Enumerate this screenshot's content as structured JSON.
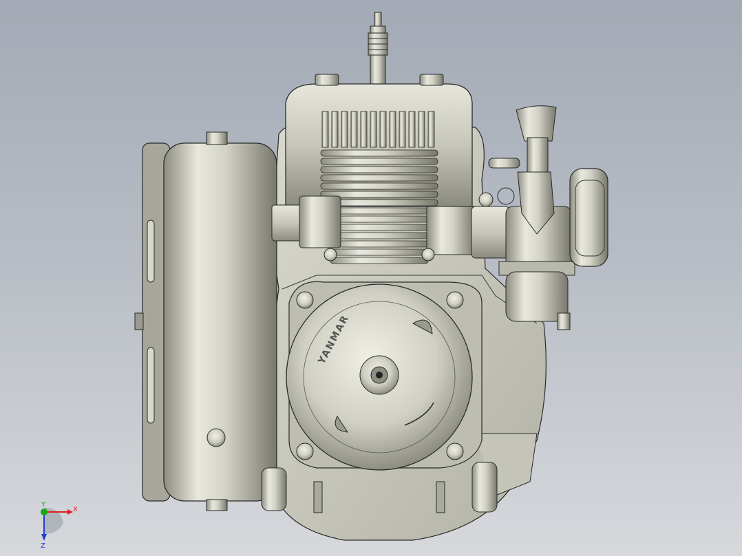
{
  "viewport": {
    "background_top": "#a3aab5",
    "background_bottom": "#d6d8dc",
    "model_color": "#c9c9bd",
    "edge_color": "#2a2a2a"
  },
  "model": {
    "name": "engine-assembly",
    "brand_text": "YANMAR"
  },
  "triad": {
    "x_label": "X",
    "y_label": "Y",
    "z_label": "Z",
    "x_color": "#e02020",
    "y_color": "#18a818",
    "z_color": "#2040d0"
  }
}
